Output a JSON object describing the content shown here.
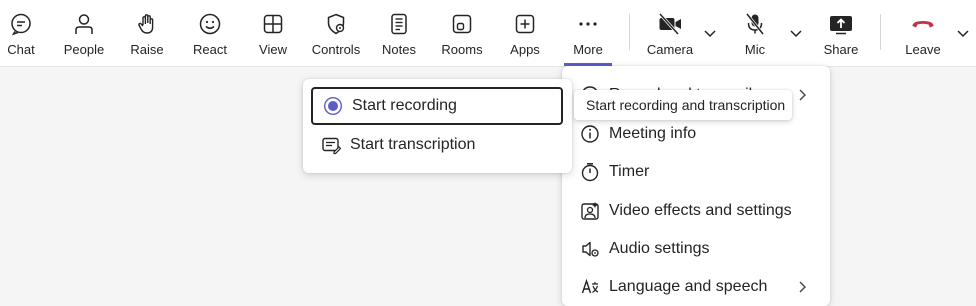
{
  "toolbar": {
    "chat": "Chat",
    "people": "People",
    "raise": "Raise",
    "react": "React",
    "view": "View",
    "controls": "Controls",
    "notes": "Notes",
    "rooms": "Rooms",
    "apps": "Apps",
    "more": "More",
    "camera": "Camera",
    "mic": "Mic",
    "share": "Share",
    "leave": "Leave"
  },
  "more_menu": {
    "items": [
      {
        "label": "Record and transcribe",
        "icon": "record-icon"
      },
      {
        "label": "Meeting info",
        "icon": "info-icon"
      },
      {
        "label": "Timer",
        "icon": "timer-icon"
      },
      {
        "label": "Video effects and settings",
        "icon": "video-effects-icon"
      },
      {
        "label": "Audio settings",
        "icon": "audio-settings-icon"
      },
      {
        "label": "Language and speech",
        "icon": "language-icon"
      }
    ]
  },
  "record_submenu": {
    "start_recording": "Start recording",
    "start_transcription": "Start transcription"
  },
  "tooltip": {
    "text": "Start recording and transcription"
  },
  "colors": {
    "accent": "#5b5fc7",
    "leave_red": "#c4314b"
  }
}
